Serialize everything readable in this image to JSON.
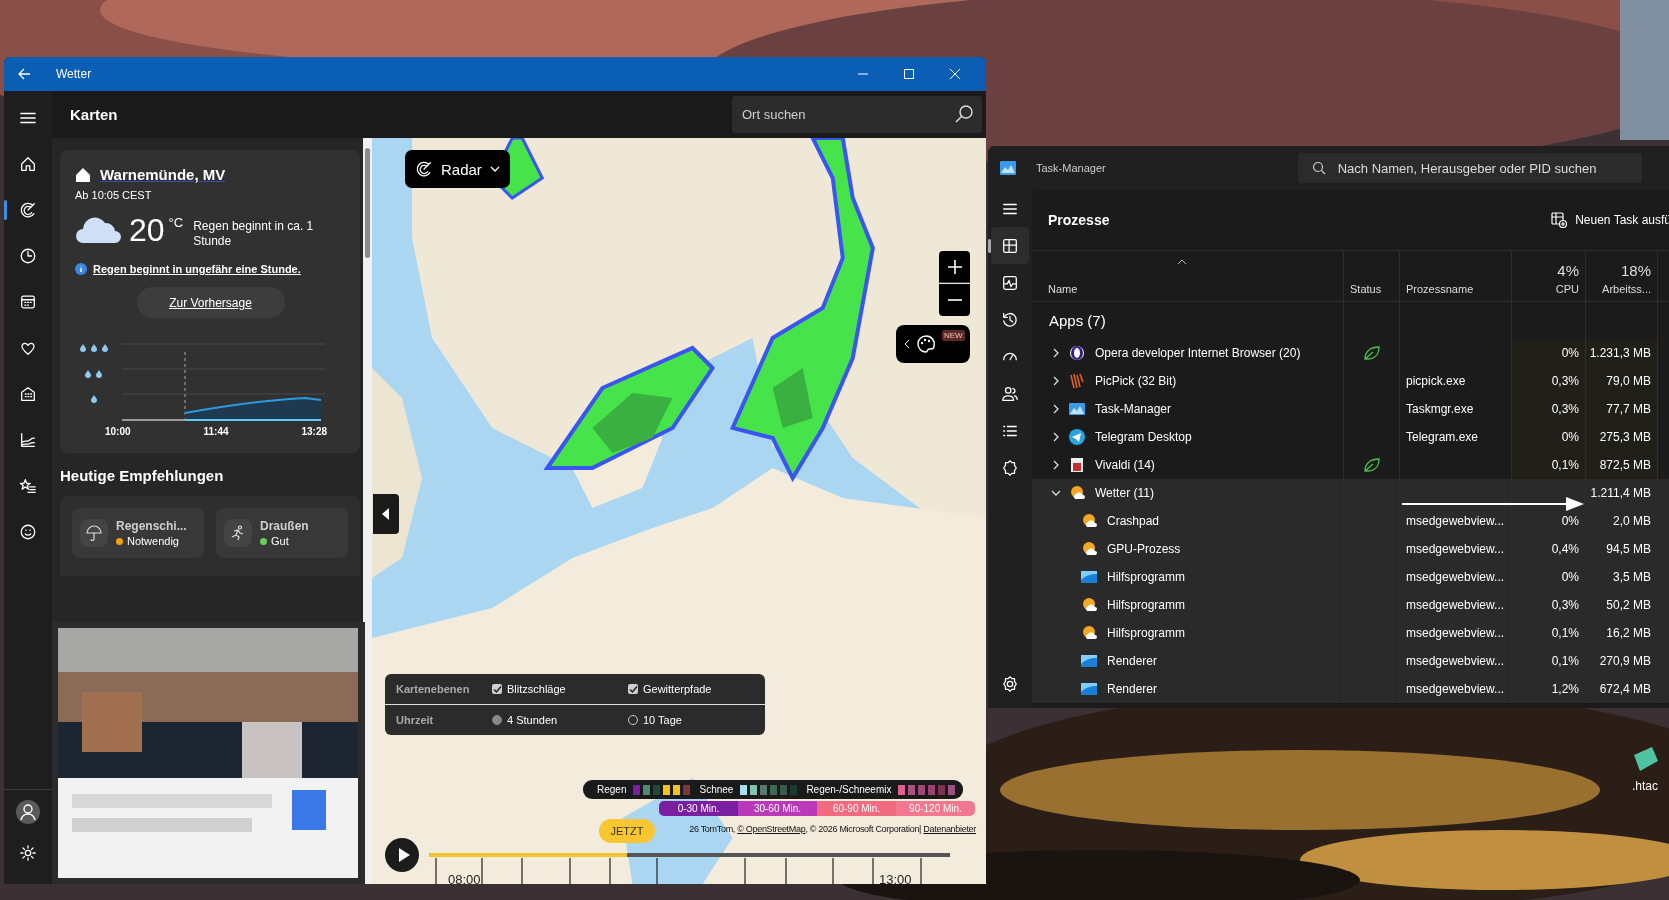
{
  "weather_app": {
    "title": "Wetter",
    "nav": [
      {
        "kind": "home",
        "selected": false
      },
      {
        "kind": "radar",
        "selected": true
      },
      {
        "kind": "clock",
        "selected": false
      },
      {
        "kind": "calendar",
        "selected": false
      },
      {
        "kind": "heart",
        "selected": false
      },
      {
        "kind": "building",
        "selected": false
      },
      {
        "kind": "chart",
        "selected": false
      },
      {
        "kind": "star-list",
        "selected": false
      },
      {
        "kind": "smiley",
        "selected": false
      }
    ],
    "page_title": "Karten",
    "search": {
      "placeholder": "Ort suchen"
    },
    "current": {
      "location": "Warnemünde, MV",
      "time": "Ab 10:05 CEST",
      "temperature": "20",
      "unit": "°C",
      "summary": "Regen beginnt in ca. 1 Stunde",
      "alert": "Regen beginnt in ungefähr eine Stunde.",
      "button": "Zur Vorhersage",
      "chart_times": [
        "10:00",
        "11:44",
        "13:28"
      ]
    },
    "recommendations": {
      "title": "Heutige Empfehlungen",
      "items": [
        {
          "kind": "umbrella",
          "name": "Regenschi...",
          "status": "Notwendig",
          "color": "#f0a30a"
        },
        {
          "kind": "runner",
          "name": "Draußen",
          "status": "Gut",
          "color": "#6ccb5f"
        }
      ]
    },
    "map": {
      "layer_button": "Radar",
      "badge": "NEW",
      "layers": [
        {
          "label": "Kartenebenen",
          "options": [
            {
              "kind": "checkbox",
              "label": "Blitzschläge",
              "checked": true
            },
            {
              "kind": "checkbox",
              "label": "Gewitterpfade",
              "checked": true
            }
          ]
        },
        {
          "label": "Uhrzeit",
          "options": [
            {
              "kind": "radio",
              "label": "4 Stunden",
              "selected": true
            },
            {
              "kind": "radio",
              "label": "10 Tage",
              "selected": false
            }
          ]
        }
      ],
      "legend": [
        {
          "label": "Regen",
          "swatches": [
            {
              "color": "#7a1fa2"
            },
            {
              "color": "#4e8a72"
            },
            {
              "color": "#1f4a38"
            },
            {
              "color": "#f5c21b"
            },
            {
              "color": "#f5c21b"
            },
            {
              "color": "#7a3a3a"
            }
          ]
        },
        {
          "label": "Schnee",
          "swatches": [
            {
              "color": "#a8e0f0"
            },
            {
              "color": "#7fc4b0"
            },
            {
              "color": "#5a7a70"
            },
            {
              "color": "#3e6a5a"
            },
            {
              "color": "#3a5a4e"
            },
            {
              "color": "#1e3a30"
            }
          ]
        },
        {
          "label": "Regen-/Schneemix",
          "swatches": [
            {
              "color": "#e06090"
            },
            {
              "color": "#b05080"
            },
            {
              "color": "#a04878"
            },
            {
              "color": "#a04070"
            },
            {
              "color": "#803050"
            },
            {
              "color": "#a05080"
            }
          ]
        }
      ],
      "time_ranges": [
        {
          "label": "0-30 Min.",
          "color": "#7a1fa2"
        },
        {
          "label": "30-60 Min.",
          "color": "#b83ab8"
        },
        {
          "label": "60-90 Min.",
          "color": "#f06a80"
        },
        {
          "label": "90-120 Min.",
          "color": "#f27890"
        }
      ],
      "attribution": {
        "prefix": "26 TomTom,",
        "osm": "© OpenStreetMap",
        "suffix": ", © 2026 Microsoft Corporation|",
        "provider": "Datenanbieter"
      },
      "timeline": {
        "now": "JETZT",
        "level": 0.38,
        "times": [
          "08:00",
          "13:00"
        ]
      }
    }
  },
  "task_manager": {
    "title": "Task-Manager",
    "search": {
      "placeholder": "Nach Namen, Herausgeber oder PID suchen"
    },
    "nav": [
      {
        "kind": "processes",
        "selected": true
      },
      {
        "kind": "performance",
        "selected": false
      },
      {
        "kind": "history",
        "selected": false
      },
      {
        "kind": "startup",
        "selected": false
      },
      {
        "kind": "users",
        "selected": false
      },
      {
        "kind": "details",
        "selected": false
      },
      {
        "kind": "services",
        "selected": false
      }
    ],
    "section_title": "Prozesse",
    "run_task": "Neuen Task ausfü",
    "columns": [
      {
        "label": "Name"
      },
      {
        "label": "Status"
      },
      {
        "label": "Prozessname"
      },
      {
        "label": "CPU",
        "total": "4%"
      },
      {
        "label": "Arbeitss...",
        "total": "18%"
      }
    ],
    "group": "Apps (7)",
    "rows": [
      {
        "kind": "ring",
        "name": "Opera developer Internet Browser (20)",
        "expanded": false,
        "selected": false,
        "efficiency": true,
        "cpu": "0%",
        "memory": "1.231,3 MB"
      },
      {
        "kind": "stripes",
        "name": "PicPick (32 Bit)",
        "expanded": false,
        "selected": false,
        "efficiency": false,
        "process": "picpick.exe",
        "cpu": "0,3%",
        "memory": "79,0 MB"
      },
      {
        "kind": "monitor",
        "name": "Task-Manager",
        "expanded": false,
        "selected": false,
        "efficiency": false,
        "process": "Taskmgr.exe",
        "cpu": "0,3%",
        "memory": "77,7 MB"
      },
      {
        "kind": "plane",
        "name": "Telegram Desktop",
        "expanded": false,
        "selected": false,
        "efficiency": false,
        "process": "Telegram.exe",
        "cpu": "0%",
        "memory": "275,3 MB"
      },
      {
        "kind": "square",
        "name": "Vivaldi (14)",
        "expanded": false,
        "selected": false,
        "efficiency": true,
        "cpu": "0,1%",
        "memory": "872,5 MB"
      },
      {
        "kind": "sun",
        "name": "Wetter (11)",
        "expanded": true,
        "selected": true,
        "efficiency": false,
        "memory": "1.211,4 MB",
        "children": [
          {
            "kind": "sun",
            "name": "Crashpad",
            "process": "msedgewebview...",
            "cpu": "0%",
            "memory": "2,0 MB"
          },
          {
            "kind": "sun",
            "name": "GPU-Prozess",
            "process": "msedgewebview...",
            "cpu": "0,4%",
            "memory": "94,5 MB"
          },
          {
            "kind": "window",
            "name": "Hilfsprogramm",
            "process": "msedgewebview...",
            "cpu": "0%",
            "memory": "3,5 MB"
          },
          {
            "kind": "sun",
            "name": "Hilfsprogramm",
            "process": "msedgewebview...",
            "cpu": "0,3%",
            "memory": "50,2 MB"
          },
          {
            "kind": "sun",
            "name": "Hilfsprogramm",
            "process": "msedgewebview...",
            "cpu": "0,1%",
            "memory": "16,2 MB"
          },
          {
            "kind": "window",
            "name": "Renderer",
            "process": "msedgewebview...",
            "cpu": "0,1%",
            "memory": "270,9 MB"
          },
          {
            "kind": "window",
            "name": "Renderer",
            "process": "msedgewebview...",
            "cpu": "1,2%",
            "memory": "672,4 MB"
          }
        ]
      }
    ]
  },
  "desktop_icons": [
    {
      "label": ".htac"
    }
  ]
}
